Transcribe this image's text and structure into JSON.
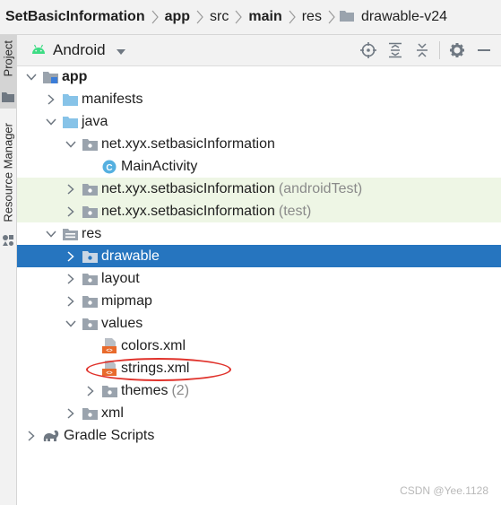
{
  "breadcrumb": {
    "items": [
      "SetBasicInformation",
      "app",
      "src",
      "main",
      "res",
      "drawable-v24"
    ]
  },
  "sidebar": {
    "tabs": [
      "Project",
      "Resource Manager"
    ]
  },
  "toolbar": {
    "view_mode": "Android"
  },
  "tree": {
    "rows": [
      {
        "label": "app",
        "extra": "",
        "icon": "module-folder-icon",
        "expanded": true
      },
      {
        "label": "manifests",
        "extra": "",
        "icon": "folder-icon",
        "expanded": false
      },
      {
        "label": "java",
        "extra": "",
        "icon": "folder-icon",
        "expanded": true
      },
      {
        "label": "net.xyx.setbasicInformation",
        "extra": "",
        "icon": "package-icon",
        "expanded": true
      },
      {
        "label": "MainActivity",
        "extra": "",
        "icon": "class-icon",
        "expanded": null
      },
      {
        "label": "net.xyx.setbasicInformation",
        "extra": "(androidTest)",
        "icon": "package-icon",
        "expanded": false
      },
      {
        "label": "net.xyx.setbasicInformation",
        "extra": "(test)",
        "icon": "package-icon",
        "expanded": false
      },
      {
        "label": "res",
        "extra": "",
        "icon": "res-folder-icon",
        "expanded": true
      },
      {
        "label": "drawable",
        "extra": "",
        "icon": "package-icon",
        "expanded": false
      },
      {
        "label": "layout",
        "extra": "",
        "icon": "package-icon",
        "expanded": false
      },
      {
        "label": "mipmap",
        "extra": "",
        "icon": "package-icon",
        "expanded": false
      },
      {
        "label": "values",
        "extra": "",
        "icon": "package-icon",
        "expanded": true
      },
      {
        "label": "colors.xml",
        "extra": "",
        "icon": "xml-file-icon",
        "expanded": null
      },
      {
        "label": "strings.xml",
        "extra": "",
        "icon": "xml-file-icon",
        "expanded": null
      },
      {
        "label": "themes",
        "extra": "(2)",
        "icon": "package-icon",
        "expanded": false
      },
      {
        "label": "xml",
        "extra": "",
        "icon": "package-icon",
        "expanded": false
      },
      {
        "label": "Gradle Scripts",
        "extra": "",
        "icon": "gradle-icon",
        "expanded": false
      }
    ]
  },
  "watermark": "CSDN @Yee.1128",
  "colors": {
    "selection": "#2675bf",
    "test_row": "#eef6e5",
    "highlight_ellipse": "#e0322b",
    "android_green": "#3ddc84"
  }
}
